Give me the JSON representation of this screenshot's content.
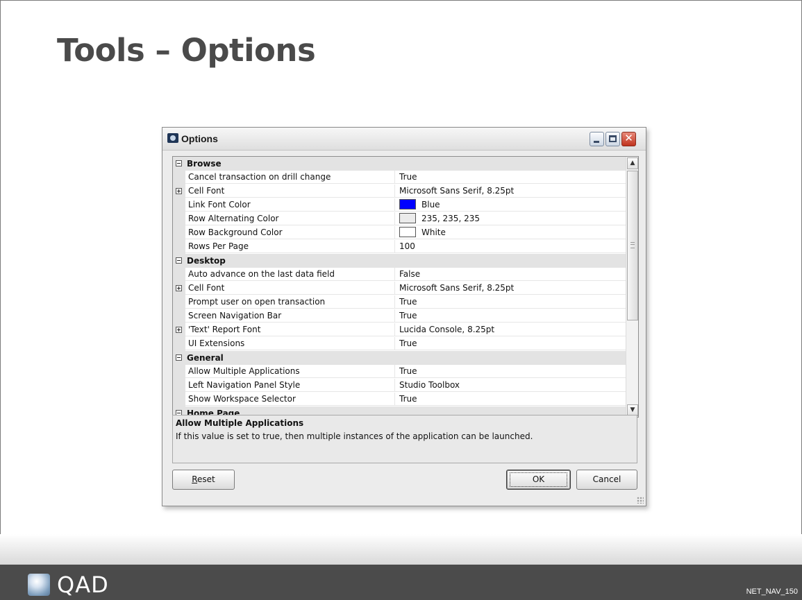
{
  "slide": {
    "title": "Tools – Options",
    "footer_code": "NET_NAV_150",
    "logo_text": "QAD"
  },
  "dialog": {
    "title": "Options",
    "rows": [
      {
        "type": "category",
        "label": "Browse",
        "toggle": "minus"
      },
      {
        "type": "prop",
        "name": "Cancel transaction on drill change",
        "value": "True"
      },
      {
        "type": "prop",
        "name": "Cell Font",
        "value": "Microsoft Sans Serif, 8.25pt",
        "toggle": "plus"
      },
      {
        "type": "prop",
        "name": "Link Font Color",
        "value": "Blue",
        "swatch": "#0000ff"
      },
      {
        "type": "prop",
        "name": "Row Alternating Color",
        "value": "235, 235, 235",
        "swatch": "#ebebeb"
      },
      {
        "type": "prop",
        "name": "Row Background Color",
        "value": "White",
        "swatch": "#ffffff"
      },
      {
        "type": "prop",
        "name": "Rows Per Page",
        "value": "100"
      },
      {
        "type": "category",
        "label": "Desktop",
        "toggle": "minus"
      },
      {
        "type": "prop",
        "name": "Auto advance on the last data field",
        "value": "False"
      },
      {
        "type": "prop",
        "name": "Cell Font",
        "value": "Microsoft Sans Serif, 8.25pt",
        "toggle": "plus"
      },
      {
        "type": "prop",
        "name": "Prompt user on open transaction",
        "value": "True"
      },
      {
        "type": "prop",
        "name": "Screen Navigation Bar",
        "value": "True"
      },
      {
        "type": "prop",
        "name": "'Text' Report Font",
        "value": "Lucida Console, 8.25pt",
        "toggle": "plus"
      },
      {
        "type": "prop",
        "name": "UI Extensions",
        "value": "True"
      },
      {
        "type": "category",
        "label": "General",
        "toggle": "minus"
      },
      {
        "type": "prop",
        "name": "Allow Multiple Applications",
        "value": "True"
      },
      {
        "type": "prop",
        "name": "Left Navigation Panel Style",
        "value": "Studio Toolbox"
      },
      {
        "type": "prop",
        "name": "Show Workspace Selector",
        "value": "True"
      },
      {
        "type": "category",
        "label": "Home Page",
        "toggle": "minus"
      }
    ],
    "help": {
      "title": "Allow Multiple Applications",
      "text": "If this value is set to true, then multiple instances of the application can be launched."
    },
    "buttons": {
      "reset_accel": "R",
      "reset_rest": "eset",
      "ok": "OK",
      "cancel": "Cancel"
    },
    "window_controls": {
      "close_glyph": "✕"
    },
    "scrollbar": {
      "up_glyph": "▲",
      "down_glyph": "▼"
    }
  }
}
